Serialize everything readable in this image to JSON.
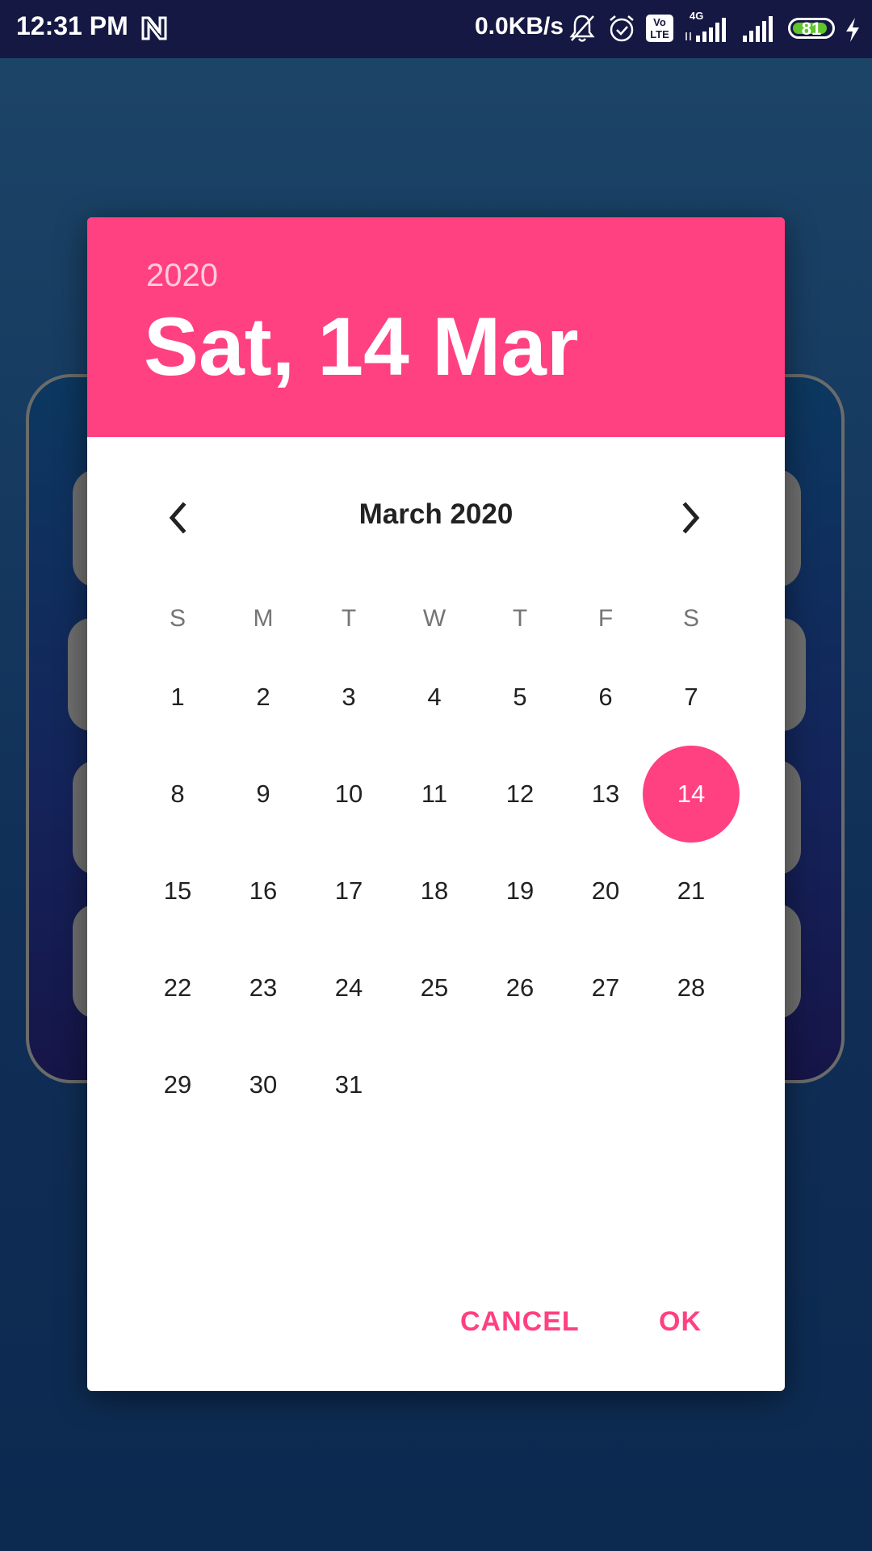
{
  "status_bar": {
    "time": "12:31 PM",
    "network_speed": "0.0KB/s",
    "network_type": "4G",
    "volte_label_top": "Vo",
    "volte_label_bottom": "LTE",
    "battery_level": "81",
    "icons": [
      "n-app-icon",
      "mute-bell-icon",
      "alarm-icon",
      "volte-icon",
      "signal-4g-icon",
      "signal-icon",
      "battery-icon",
      "charging-icon"
    ]
  },
  "dialog": {
    "year": "2020",
    "date": "Sat, 14 Mar",
    "month_title": "March 2020",
    "weekdays": [
      "S",
      "M",
      "T",
      "W",
      "T",
      "F",
      "S"
    ],
    "days": [
      "1",
      "2",
      "3",
      "4",
      "5",
      "6",
      "7",
      "8",
      "9",
      "10",
      "11",
      "12",
      "13",
      "14",
      "15",
      "16",
      "17",
      "18",
      "19",
      "20",
      "21",
      "22",
      "23",
      "24",
      "25",
      "26",
      "27",
      "28",
      "29",
      "30",
      "31"
    ],
    "first_weekday_index": 0,
    "selected_day": "14",
    "cancel_label": "CANCEL",
    "ok_label": "OK"
  },
  "colors": {
    "accent": "#ff4081",
    "status_bar": "#151842",
    "battery_fill": "#5fc52a"
  }
}
